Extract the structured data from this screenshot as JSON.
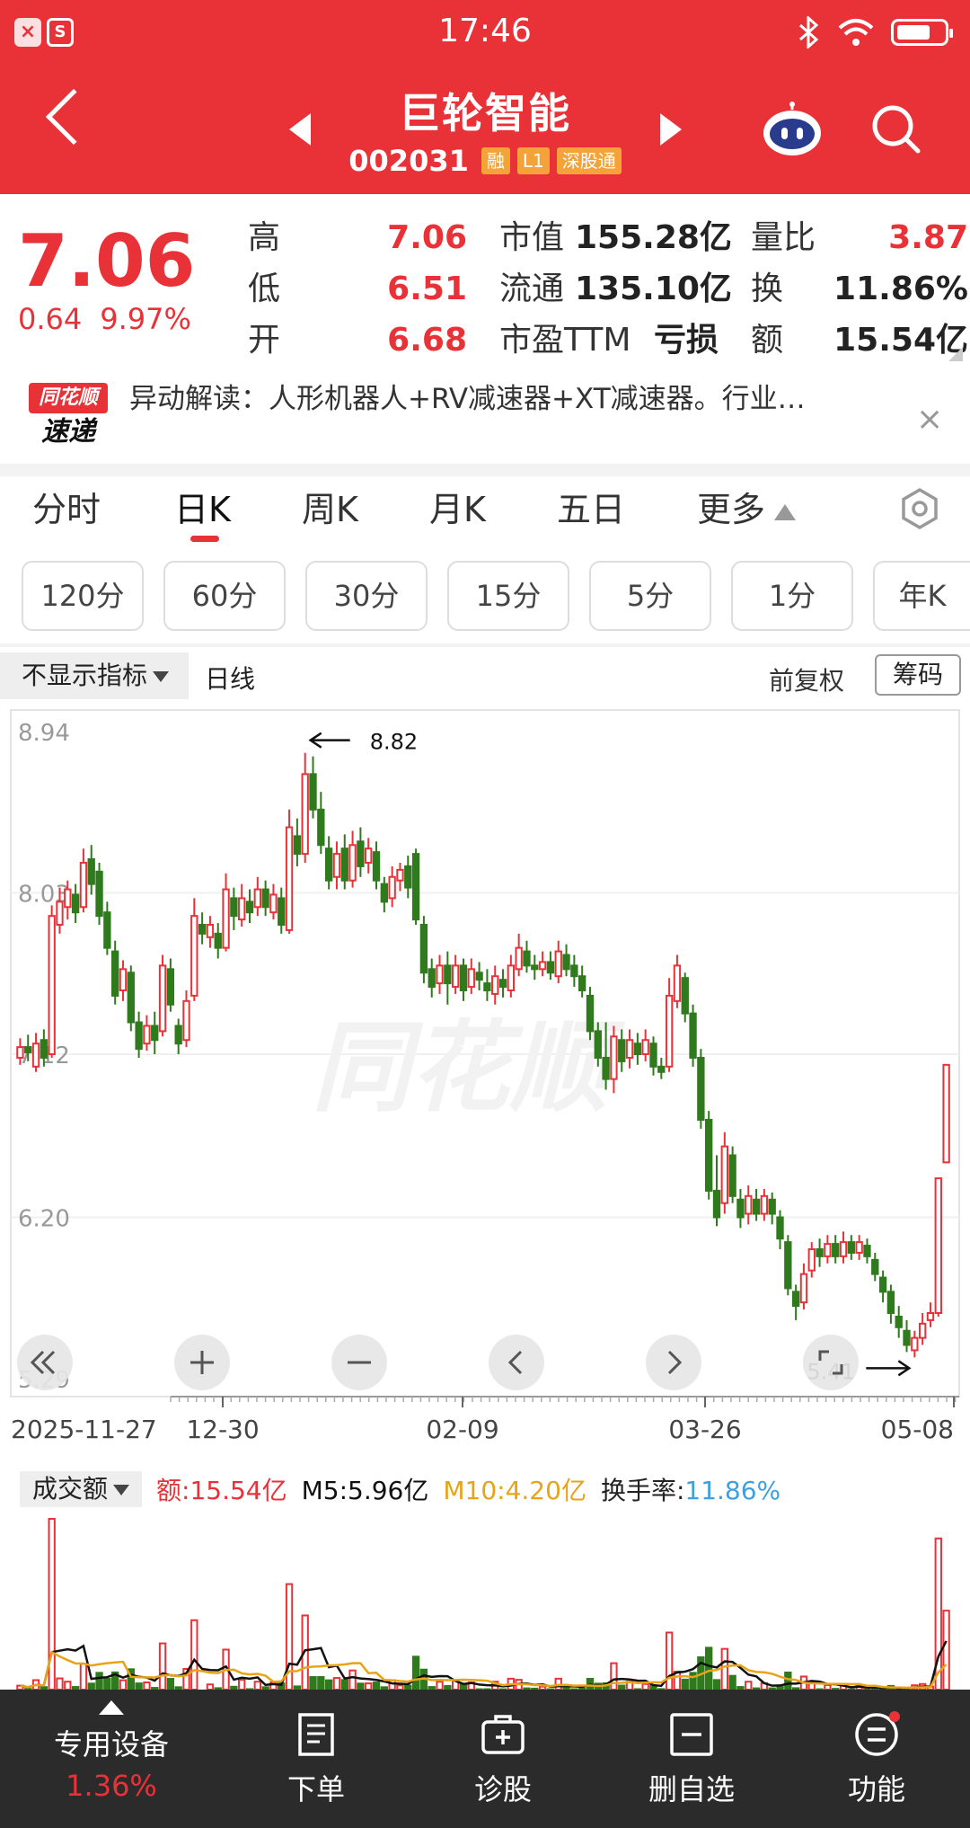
{
  "status_bar": {
    "time": "17:46",
    "badge_1": "×",
    "badge_2": "S"
  },
  "header": {
    "stock_name": "巨轮智能",
    "stock_code": "002031",
    "tags": [
      "融",
      "L1",
      "深股通"
    ]
  },
  "quote": {
    "price": "7.06",
    "change": "0.64",
    "change_pct": "9.97%",
    "fields": [
      {
        "label": "高",
        "value": "7.06"
      },
      {
        "label": "低",
        "value": "6.51"
      },
      {
        "label": "开",
        "value": "6.68"
      },
      {
        "label": "市值",
        "value": "155.28亿"
      },
      {
        "label": "流通",
        "value": "135.10亿"
      },
      {
        "label": "市盈TTM",
        "value": "亏损"
      },
      {
        "label": "量比",
        "value": "3.87"
      },
      {
        "label": "换",
        "value": "11.86%"
      },
      {
        "label": "额",
        "value": "15.54亿"
      }
    ]
  },
  "news": {
    "logo_top": "同花顺",
    "logo_bottom": "速递",
    "text": "异动解读：人形机器人+RV减速器+XT减速器。行业…",
    "close": "×"
  },
  "tabs": [
    "分时",
    "日K",
    "周K",
    "月K",
    "五日",
    "更多"
  ],
  "active_tab": "日K",
  "periods": [
    "120分",
    "60分",
    "30分",
    "15分",
    "5分",
    "1分",
    "年K"
  ],
  "chart_toolbar": {
    "indicator": "不显示指标",
    "line_type": "日线",
    "adjust": "前复权",
    "chips": "筹码"
  },
  "chart_data": {
    "type": "candlestick",
    "y_ticks": [
      "8.94",
      "8.03",
      "7.12",
      "6.20",
      "5.29"
    ],
    "ylim": [
      5.29,
      8.94
    ],
    "x_ticks": [
      "2025-11-27",
      "12-30",
      "02-09",
      "03-26",
      "05-08"
    ],
    "high_marker": "8.82",
    "low_marker": "5.41",
    "watermark": "同花顺",
    "candles": [
      {
        "o": 7.1,
        "c": 7.16,
        "h": 7.21,
        "l": 7.06
      },
      {
        "o": 7.16,
        "c": 7.13,
        "h": 7.23,
        "l": 7.08
      },
      {
        "o": 7.05,
        "c": 7.18,
        "h": 7.24,
        "l": 7.02
      },
      {
        "o": 7.2,
        "c": 7.1,
        "h": 7.26,
        "l": 7.05
      },
      {
        "o": 7.12,
        "c": 7.9,
        "h": 7.96,
        "l": 7.1
      },
      {
        "o": 7.85,
        "c": 7.98,
        "h": 8.06,
        "l": 7.8
      },
      {
        "o": 7.95,
        "c": 8.05,
        "h": 8.1,
        "l": 7.88
      },
      {
        "o": 8.02,
        "c": 7.92,
        "h": 8.08,
        "l": 7.86
      },
      {
        "o": 7.95,
        "c": 8.2,
        "h": 8.28,
        "l": 7.92
      },
      {
        "o": 8.22,
        "c": 8.08,
        "h": 8.3,
        "l": 8.02
      },
      {
        "o": 8.15,
        "c": 7.9,
        "h": 8.2,
        "l": 7.85
      },
      {
        "o": 7.92,
        "c": 7.72,
        "h": 7.98,
        "l": 7.68
      },
      {
        "o": 7.7,
        "c": 7.45,
        "h": 7.76,
        "l": 7.4
      },
      {
        "o": 7.48,
        "c": 7.6,
        "h": 7.65,
        "l": 7.42
      },
      {
        "o": 7.58,
        "c": 7.3,
        "h": 7.62,
        "l": 7.25
      },
      {
        "o": 7.3,
        "c": 7.15,
        "h": 7.36,
        "l": 7.1
      },
      {
        "o": 7.18,
        "c": 7.28,
        "h": 7.34,
        "l": 7.14
      },
      {
        "o": 7.28,
        "c": 7.2,
        "h": 7.36,
        "l": 7.12
      },
      {
        "o": 7.25,
        "c": 7.62,
        "h": 7.68,
        "l": 7.22
      },
      {
        "o": 7.6,
        "c": 7.4,
        "h": 7.66,
        "l": 7.36
      },
      {
        "o": 7.28,
        "c": 7.18,
        "h": 7.32,
        "l": 7.12
      },
      {
        "o": 7.2,
        "c": 7.42,
        "h": 7.48,
        "l": 7.16
      },
      {
        "o": 7.45,
        "c": 7.9,
        "h": 8.0,
        "l": 7.42
      },
      {
        "o": 7.85,
        "c": 7.8,
        "h": 7.92,
        "l": 7.74
      },
      {
        "o": 7.78,
        "c": 7.85,
        "h": 7.9,
        "l": 7.72
      },
      {
        "o": 7.8,
        "c": 7.72,
        "h": 7.86,
        "l": 7.66
      },
      {
        "o": 7.72,
        "c": 8.05,
        "h": 8.14,
        "l": 7.7
      },
      {
        "o": 8.0,
        "c": 7.9,
        "h": 8.06,
        "l": 7.82
      },
      {
        "o": 7.88,
        "c": 8.0,
        "h": 8.08,
        "l": 7.84
      },
      {
        "o": 7.98,
        "c": 7.92,
        "h": 8.05,
        "l": 7.86
      },
      {
        "o": 7.95,
        "c": 8.05,
        "h": 8.12,
        "l": 7.9
      },
      {
        "o": 8.05,
        "c": 7.95,
        "h": 8.1,
        "l": 7.9
      },
      {
        "o": 7.92,
        "c": 8.02,
        "h": 8.08,
        "l": 7.88
      },
      {
        "o": 8.0,
        "c": 7.85,
        "h": 8.06,
        "l": 7.8
      },
      {
        "o": 7.82,
        "c": 8.4,
        "h": 8.5,
        "l": 7.8
      },
      {
        "o": 8.35,
        "c": 8.25,
        "h": 8.45,
        "l": 8.18
      },
      {
        "o": 8.25,
        "c": 8.7,
        "h": 8.82,
        "l": 8.2
      },
      {
        "o": 8.7,
        "c": 8.5,
        "h": 8.8,
        "l": 8.45
      },
      {
        "o": 8.5,
        "c": 8.3,
        "h": 8.6,
        "l": 8.25
      },
      {
        "o": 8.28,
        "c": 8.1,
        "h": 8.35,
        "l": 8.05
      },
      {
        "o": 8.12,
        "c": 8.25,
        "h": 8.32,
        "l": 8.05
      },
      {
        "o": 8.28,
        "c": 8.1,
        "h": 8.36,
        "l": 8.05
      },
      {
        "o": 8.1,
        "c": 8.3,
        "h": 8.38,
        "l": 8.06
      },
      {
        "o": 8.32,
        "c": 8.18,
        "h": 8.4,
        "l": 8.12
      },
      {
        "o": 8.2,
        "c": 8.28,
        "h": 8.34,
        "l": 8.14
      },
      {
        "o": 8.26,
        "c": 8.1,
        "h": 8.32,
        "l": 8.05
      },
      {
        "o": 8.08,
        "c": 7.98,
        "h": 8.12,
        "l": 7.92
      },
      {
        "o": 8.0,
        "c": 8.12,
        "h": 8.18,
        "l": 7.95
      },
      {
        "o": 8.1,
        "c": 8.16,
        "h": 8.2,
        "l": 8.04
      },
      {
        "o": 8.18,
        "c": 8.06,
        "h": 8.24,
        "l": 8.0
      },
      {
        "o": 8.25,
        "c": 7.88,
        "h": 8.28,
        "l": 7.85
      },
      {
        "o": 7.85,
        "c": 7.58,
        "h": 7.9,
        "l": 7.52
      },
      {
        "o": 7.6,
        "c": 7.5,
        "h": 7.66,
        "l": 7.44
      },
      {
        "o": 7.52,
        "c": 7.62,
        "h": 7.68,
        "l": 7.46
      },
      {
        "o": 7.62,
        "c": 7.52,
        "h": 7.7,
        "l": 7.4
      },
      {
        "o": 7.5,
        "c": 7.62,
        "h": 7.68,
        "l": 7.46
      },
      {
        "o": 7.62,
        "c": 7.48,
        "h": 7.66,
        "l": 7.42
      },
      {
        "o": 7.5,
        "c": 7.6,
        "h": 7.66,
        "l": 7.46
      },
      {
        "o": 7.58,
        "c": 7.54,
        "h": 7.64,
        "l": 7.48
      },
      {
        "o": 7.52,
        "c": 7.48,
        "h": 7.6,
        "l": 7.42
      },
      {
        "o": 7.46,
        "c": 7.56,
        "h": 7.62,
        "l": 7.4
      },
      {
        "o": 7.54,
        "c": 7.5,
        "h": 7.6,
        "l": 7.44
      },
      {
        "o": 7.48,
        "c": 7.62,
        "h": 7.68,
        "l": 7.44
      },
      {
        "o": 7.6,
        "c": 7.72,
        "h": 7.8,
        "l": 7.56
      },
      {
        "o": 7.7,
        "c": 7.62,
        "h": 7.76,
        "l": 7.58
      },
      {
        "o": 7.62,
        "c": 7.6,
        "h": 7.68,
        "l": 7.54
      },
      {
        "o": 7.6,
        "c": 7.64,
        "h": 7.7,
        "l": 7.56
      },
      {
        "o": 7.64,
        "c": 7.58,
        "h": 7.7,
        "l": 7.54
      },
      {
        "o": 7.56,
        "c": 7.7,
        "h": 7.76,
        "l": 7.52
      },
      {
        "o": 7.68,
        "c": 7.6,
        "h": 7.74,
        "l": 7.56
      },
      {
        "o": 7.62,
        "c": 7.56,
        "h": 7.68,
        "l": 7.5
      },
      {
        "o": 7.56,
        "c": 7.48,
        "h": 7.62,
        "l": 7.44
      },
      {
        "o": 7.45,
        "c": 7.25,
        "h": 7.5,
        "l": 7.2
      },
      {
        "o": 7.25,
        "c": 7.1,
        "h": 7.3,
        "l": 7.05
      },
      {
        "o": 7.1,
        "c": 6.98,
        "h": 7.3,
        "l": 6.92
      },
      {
        "o": 6.98,
        "c": 7.22,
        "h": 7.28,
        "l": 6.9
      },
      {
        "o": 7.2,
        "c": 7.08,
        "h": 7.26,
        "l": 7.02
      },
      {
        "o": 7.1,
        "c": 7.2,
        "h": 7.26,
        "l": 7.04
      },
      {
        "o": 7.18,
        "c": 7.12,
        "h": 7.24,
        "l": 7.06
      },
      {
        "o": 7.12,
        "c": 7.2,
        "h": 7.26,
        "l": 7.08
      },
      {
        "o": 7.18,
        "c": 7.05,
        "h": 7.22,
        "l": 7.0
      },
      {
        "o": 7.05,
        "c": 7.02,
        "h": 7.1,
        "l": 6.98
      },
      {
        "o": 7.05,
        "c": 7.45,
        "h": 7.55,
        "l": 7.02
      },
      {
        "o": 7.42,
        "c": 7.62,
        "h": 7.68,
        "l": 7.38
      },
      {
        "o": 7.55,
        "c": 7.35,
        "h": 7.58,
        "l": 7.3
      },
      {
        "o": 7.35,
        "c": 7.1,
        "h": 7.4,
        "l": 7.05
      },
      {
        "o": 7.1,
        "c": 6.75,
        "h": 7.15,
        "l": 6.7
      },
      {
        "o": 6.75,
        "c": 6.35,
        "h": 6.8,
        "l": 6.3
      },
      {
        "o": 6.35,
        "c": 6.2,
        "h": 6.55,
        "l": 6.15
      },
      {
        "o": 6.28,
        "c": 6.6,
        "h": 6.68,
        "l": 6.22
      },
      {
        "o": 6.55,
        "c": 6.32,
        "h": 6.6,
        "l": 6.28
      },
      {
        "o": 6.3,
        "c": 6.2,
        "h": 6.36,
        "l": 6.14
      },
      {
        "o": 6.22,
        "c": 6.32,
        "h": 6.38,
        "l": 6.16
      },
      {
        "o": 6.3,
        "c": 6.22,
        "h": 6.36,
        "l": 6.18
      },
      {
        "o": 6.22,
        "c": 6.32,
        "h": 6.36,
        "l": 6.18
      },
      {
        "o": 6.3,
        "c": 6.22,
        "h": 6.34,
        "l": 6.16
      },
      {
        "o": 6.2,
        "c": 6.08,
        "h": 6.24,
        "l": 6.02
      },
      {
        "o": 6.06,
        "c": 5.8,
        "h": 6.1,
        "l": 5.76
      },
      {
        "o": 5.78,
        "c": 5.7,
        "h": 5.82,
        "l": 5.62
      },
      {
        "o": 5.72,
        "c": 5.88,
        "h": 5.94,
        "l": 5.68
      },
      {
        "o": 5.9,
        "c": 6.02,
        "h": 6.06,
        "l": 5.86
      },
      {
        "o": 6.02,
        "c": 5.98,
        "h": 6.08,
        "l": 5.92
      },
      {
        "o": 5.98,
        "c": 6.05,
        "h": 6.1,
        "l": 5.94
      },
      {
        "o": 6.05,
        "c": 5.98,
        "h": 6.1,
        "l": 5.94
      },
      {
        "o": 5.98,
        "c": 6.06,
        "h": 6.12,
        "l": 5.94
      },
      {
        "o": 6.06,
        "c": 6.0,
        "h": 6.1,
        "l": 5.96
      },
      {
        "o": 6.0,
        "c": 6.06,
        "h": 6.1,
        "l": 5.96
      },
      {
        "o": 6.04,
        "c": 5.98,
        "h": 6.08,
        "l": 5.94
      },
      {
        "o": 5.96,
        "c": 5.88,
        "h": 6.0,
        "l": 5.84
      },
      {
        "o": 5.86,
        "c": 5.78,
        "h": 5.9,
        "l": 5.72
      },
      {
        "o": 5.78,
        "c": 5.66,
        "h": 5.82,
        "l": 5.6
      },
      {
        "o": 5.64,
        "c": 5.58,
        "h": 5.7,
        "l": 5.52
      },
      {
        "o": 5.56,
        "c": 5.48,
        "h": 5.62,
        "l": 5.44
      },
      {
        "o": 5.45,
        "c": 5.52,
        "h": 5.56,
        "l": 5.41
      },
      {
        "o": 5.52,
        "c": 5.6,
        "h": 5.66,
        "l": 5.48
      },
      {
        "o": 5.62,
        "c": 5.66,
        "h": 5.72,
        "l": 5.58
      },
      {
        "o": 5.66,
        "c": 6.42,
        "h": 6.42,
        "l": 5.64
      },
      {
        "o": 6.51,
        "c": 7.06,
        "h": 7.06,
        "l": 6.51
      }
    ],
    "volume_legend": {
      "selector": "成交额",
      "amount": "额:15.54亿",
      "m5": "M5:5.96亿",
      "m10": "M10:4.20亿",
      "turnover_label": "换手率:",
      "turnover_value": "11.86%"
    },
    "colors": {
      "up": "#e93138",
      "down": "#2f7a1d",
      "m5": "#111111",
      "m10": "#e8a317",
      "turnover": "#3ba0e4"
    }
  },
  "bottom_nav": {
    "items": [
      {
        "label": "专用设备",
        "sub": "1.36%",
        "icon": "arrow-up-icon"
      },
      {
        "label": "下单",
        "icon": "order-icon"
      },
      {
        "label": "诊股",
        "icon": "diagnose-icon"
      },
      {
        "label": "删自选",
        "icon": "remove-watchlist-icon"
      },
      {
        "label": "功能",
        "icon": "function-menu-icon"
      }
    ]
  }
}
